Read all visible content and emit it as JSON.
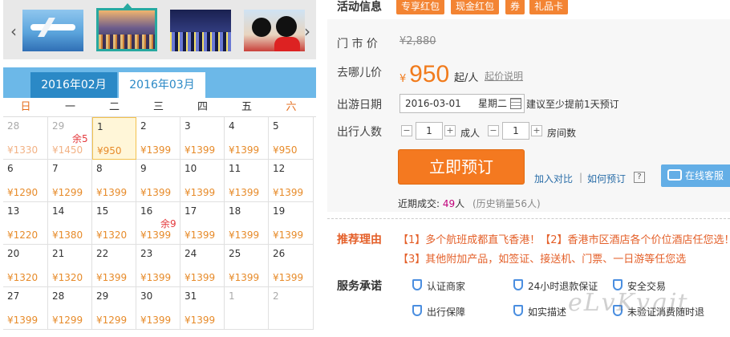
{
  "thumbnails": [
    {
      "name": "airplane"
    },
    {
      "name": "hongkong-night-harbor"
    },
    {
      "name": "hongkong-skyline"
    },
    {
      "name": "disneyland-mickey"
    }
  ],
  "calendar": {
    "tabs": [
      "2016年02月",
      "2016年03月"
    ],
    "weekdays": [
      "日",
      "一",
      "二",
      "三",
      "四",
      "五",
      "六"
    ],
    "rows": [
      [
        {
          "n": "28",
          "p": "¥1330",
          "other": true
        },
        {
          "n": "29",
          "p": "¥1450",
          "other": true,
          "left": "余5"
        },
        {
          "n": "1",
          "p": "¥950",
          "sel": true
        },
        {
          "n": "2",
          "p": "¥1399"
        },
        {
          "n": "3",
          "p": "¥1399"
        },
        {
          "n": "4",
          "p": "¥1399"
        },
        {
          "n": "5",
          "p": "¥950"
        }
      ],
      [
        {
          "n": "6",
          "p": "¥1290"
        },
        {
          "n": "7",
          "p": "¥1299"
        },
        {
          "n": "8",
          "p": "¥1399"
        },
        {
          "n": "9",
          "p": "¥1399"
        },
        {
          "n": "10",
          "p": "¥1399"
        },
        {
          "n": "11",
          "p": "¥1399"
        },
        {
          "n": "12",
          "p": "¥1399"
        }
      ],
      [
        {
          "n": "13",
          "p": "¥1220"
        },
        {
          "n": "14",
          "p": "¥1380"
        },
        {
          "n": "15",
          "p": "¥1320"
        },
        {
          "n": "16",
          "p": "¥1399",
          "left": "余9"
        },
        {
          "n": "17",
          "p": "¥1399"
        },
        {
          "n": "18",
          "p": "¥1399"
        },
        {
          "n": "19",
          "p": "¥1399"
        }
      ],
      [
        {
          "n": "20",
          "p": "¥1320"
        },
        {
          "n": "21",
          "p": "¥1320"
        },
        {
          "n": "22",
          "p": "¥1399"
        },
        {
          "n": "23",
          "p": "¥1399"
        },
        {
          "n": "24",
          "p": "¥1399"
        },
        {
          "n": "25",
          "p": "¥1399"
        },
        {
          "n": "26",
          "p": "¥1399"
        }
      ],
      [
        {
          "n": "27",
          "p": "¥1399"
        },
        {
          "n": "28",
          "p": "¥1299"
        },
        {
          "n": "29",
          "p": "¥1299"
        },
        {
          "n": "30",
          "p": "¥1399"
        },
        {
          "n": "31",
          "p": "¥1399"
        },
        {
          "n": "1",
          "p": "",
          "other": true,
          "empty": true
        },
        {
          "n": "2",
          "p": "",
          "other": true,
          "empty": true
        }
      ]
    ]
  },
  "promo": {
    "label": "活动信息",
    "tags": [
      "专享红包",
      "现金红包",
      "券",
      "礼品卡"
    ]
  },
  "price": {
    "market_label": "门 市 价",
    "market_value": "¥2,880",
    "qunar_label": "去哪儿价",
    "yen": "¥",
    "value": "950",
    "unit": "起/人",
    "explain": "起价说明"
  },
  "date": {
    "label": "出游日期",
    "value": "2016-03-01",
    "weekday": "星期二",
    "hint": "建议至少提前1天预订"
  },
  "people": {
    "label": "出行人数",
    "adults": "1",
    "adult_unit": "成人",
    "rooms": "1",
    "room_unit": "房间数",
    "minus": "−",
    "plus": "+"
  },
  "actions": {
    "book": "立即预订",
    "compare": "加入对比",
    "sep": "|",
    "how": "如何预订",
    "help": "?",
    "cs": "在线客服"
  },
  "recent": {
    "prefix": "近期成交:",
    "count": "49",
    "suffix": "人",
    "history": "(历史销量56人)"
  },
  "reason": {
    "label": "推荐理由",
    "text": "【1】多个航班成都直飞香港！【2】香港市区酒店各个价位酒店任您选！【3】其他附加产品，如签证、接送机、门票、一日游等任您选"
  },
  "promise": {
    "label": "服务承诺",
    "items": [
      "认证商家",
      "24小时退款保证",
      "安全交易",
      "出行保障",
      "如实描述",
      "未验证消费随时退"
    ]
  },
  "watermark": "eLvKvgjt"
}
